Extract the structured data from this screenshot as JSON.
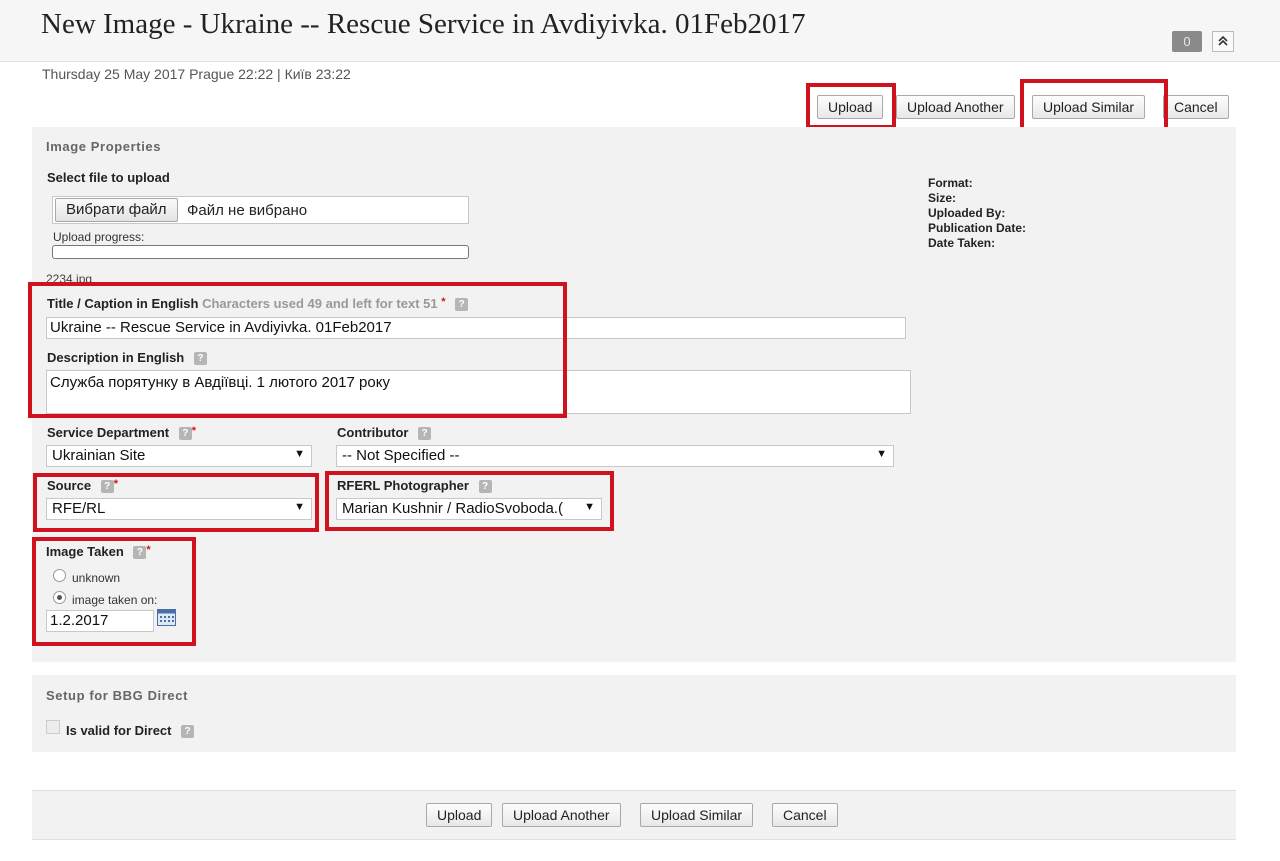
{
  "header": {
    "title": "New Image - Ukraine -- Rescue Service in Avdiyivka. 01Feb2017",
    "counter": "0",
    "collapse_icon": "chevron-up-double-icon"
  },
  "datetime": "Thursday 25 May 2017 Prague 22:22 | Київ 23:22",
  "actions": {
    "upload": "Upload",
    "upload_another": "Upload Another",
    "upload_similar": "Upload Similar",
    "cancel": "Cancel"
  },
  "image_properties": {
    "section_title": "Image Properties",
    "select_file_label": "Select file to upload",
    "choose_file_button": "Вибрати файл",
    "no_file_text": "Файл не вибрано",
    "upload_progress_label": "Upload progress:",
    "upload_progress": 0,
    "filename": "2234.jpg",
    "meta": {
      "format": "Format:",
      "size": "Size:",
      "uploaded_by": "Uploaded By:",
      "publication_date": "Publication Date:",
      "date_taken": "Date Taken:"
    },
    "title_caption": {
      "label": "Title / Caption in English",
      "hint": "Characters used 49 and left for text 51",
      "value": "Ukraine -- Rescue Service in Avdiyivka. 01Feb2017"
    },
    "description": {
      "label": "Description in English",
      "value": "Служба порятунку в Авдіївці. 1 лютого 2017 року"
    },
    "service_department": {
      "label": "Service Department",
      "value": "Ukrainian Site"
    },
    "contributor": {
      "label": "Contributor",
      "value": "-- Not Specified --"
    },
    "source": {
      "label": "Source",
      "value": "RFE/RL"
    },
    "photographer": {
      "label": "RFERL Photographer",
      "value": "Marian Kushnir / RadioSvoboda.("
    },
    "image_taken": {
      "label": "Image Taken",
      "option_unknown": "unknown",
      "option_taken_on": "image taken on:",
      "selected": "taken_on",
      "date": "1.2.2017"
    }
  },
  "bbg": {
    "section_title": "Setup for BBG Direct",
    "valid_label": "Is valid for Direct",
    "valid_checked": false
  },
  "colors": {
    "highlight": "#d0121e",
    "panel": "#f2f2f2"
  }
}
